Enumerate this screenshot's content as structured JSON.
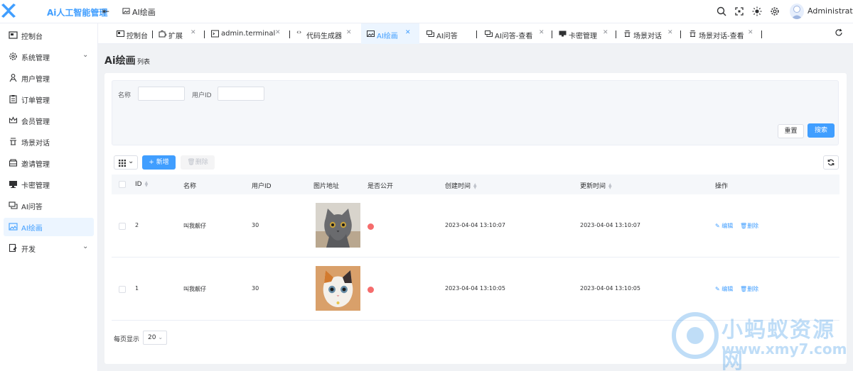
{
  "header": {
    "brand": "Ai人工智能管理",
    "collapse": "⇷",
    "breadcrumb": "AI绘画",
    "user": "Administrator"
  },
  "sidebar": {
    "items": [
      {
        "label": "控制台",
        "icon": "dashboard-icon"
      },
      {
        "label": "系统管理",
        "icon": "gear-icon",
        "expandable": true
      },
      {
        "label": "用户管理",
        "icon": "user-icon"
      },
      {
        "label": "订单管理",
        "icon": "clipboard-icon"
      },
      {
        "label": "会员管理",
        "icon": "crown-icon"
      },
      {
        "label": "场景对话",
        "icon": "scene-icon"
      },
      {
        "label": "邀请管理",
        "icon": "invite-icon"
      },
      {
        "label": "卡密管理",
        "icon": "card-icon"
      },
      {
        "label": "AI问答",
        "icon": "chat-icon"
      },
      {
        "label": "AI绘画",
        "icon": "image-icon",
        "active": true
      },
      {
        "label": "开发",
        "icon": "dev-icon",
        "expandable": true
      }
    ]
  },
  "tabs": [
    {
      "label": "控制台"
    },
    {
      "label": "扩展"
    },
    {
      "label": "admin.terminal"
    },
    {
      "label": "代码生成器"
    },
    {
      "label": "AI绘画",
      "active": true
    },
    {
      "label": "AI问答"
    },
    {
      "label": "AI问答-查看"
    },
    {
      "label": "卡密管理"
    },
    {
      "label": "场景对话"
    },
    {
      "label": "场景对话-查看"
    }
  ],
  "page": {
    "title": "Ai绘画",
    "subtitle": "列表"
  },
  "search": {
    "name_label": "名称",
    "name_value": "",
    "user_id_label": "用户ID",
    "user_id_value": "",
    "reset": "重置",
    "submit": "搜索"
  },
  "toolbar": {
    "add": "+ 新增",
    "delete": "删除"
  },
  "table": {
    "columns": [
      "ID",
      "名称",
      "用户ID",
      "图片地址",
      "是否公开",
      "创建时间",
      "更新时间",
      "操作"
    ],
    "rows": [
      {
        "id": "2",
        "name": "叫我靓仔",
        "user_id": "30",
        "image": "grey-cat",
        "public": false,
        "created": "2023-04-04 13:10:07",
        "updated": "2023-04-04 13:10:07"
      },
      {
        "id": "1",
        "name": "叫我靓仔",
        "user_id": "30",
        "image": "calico-cat",
        "public": false,
        "created": "2023-04-04 13:10:05",
        "updated": "2023-04-04 13:10:05"
      }
    ],
    "edit": "编辑",
    "remove": "删除"
  },
  "pager": {
    "label": "每页显示",
    "page_size": "20"
  },
  "watermark": {
    "title": "小蚂蚁资源网",
    "url": "www.xmy7.com"
  },
  "colors": {
    "primary": "#409eff",
    "danger": "#f56c6c"
  }
}
